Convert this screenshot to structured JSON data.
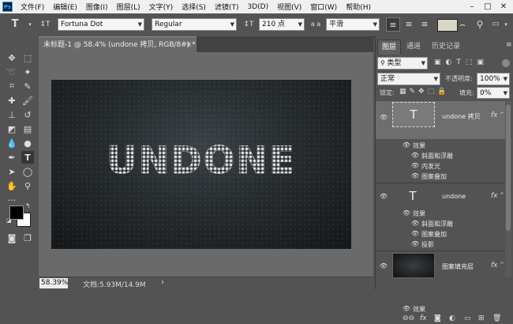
{
  "menubar": {
    "app_badge": "Ps",
    "items": [
      "文件(F)",
      "编辑(E)",
      "图像(I)",
      "图层(L)",
      "文字(Y)",
      "选择(S)",
      "滤镜(T)",
      "3D(D)",
      "视图(V)",
      "窗口(W)",
      "帮助(H)"
    ],
    "min": "–",
    "max": "□",
    "close": "✕"
  },
  "options": {
    "tool_glyph": "T",
    "orient_glyph": "↕T",
    "font_family": "Fortuna Dot",
    "font_style": "Regular",
    "size_glyph": "↕T",
    "font_size": "210 点",
    "aa_glyph": "a a",
    "antialias": "平滑",
    "color_swatch": "#d8d6c5"
  },
  "doc_tab": {
    "title": "未标题-1 @ 58.4% (undone 拷贝, RGB/8#) *",
    "close": "×"
  },
  "canvas": {
    "text": "UNDONE"
  },
  "status": {
    "zoom": "58.39%",
    "doc_info": "文档:5.93M/14.9M",
    "arrow": "›"
  },
  "panel": {
    "tabs": [
      "图层",
      "通道",
      "历史记录"
    ],
    "filter_label": "类型",
    "blend_mode": "正常",
    "opacity_label": "不透明度:",
    "opacity": "100%",
    "lock_label": "锁定:",
    "fill_label": "填充:",
    "fill": "0%",
    "layers": [
      {
        "name": "undone 拷贝",
        "thumb": "T",
        "fx": "fx",
        "effects_label": "效果",
        "effects": [
          "斜面和浮雕",
          "内发光",
          "图案叠加"
        ]
      },
      {
        "name": "undone",
        "thumb": "T",
        "fx": "fx",
        "effects_label": "效果",
        "effects": [
          "斜面和浮雕",
          "图案叠加",
          "投影"
        ]
      },
      {
        "name": "图案填充层",
        "thumb": "",
        "fx": "fx",
        "effects_label": "效果",
        "effects": []
      }
    ]
  },
  "colors": {
    "fg": "#000000",
    "bg": "#ffffff"
  }
}
